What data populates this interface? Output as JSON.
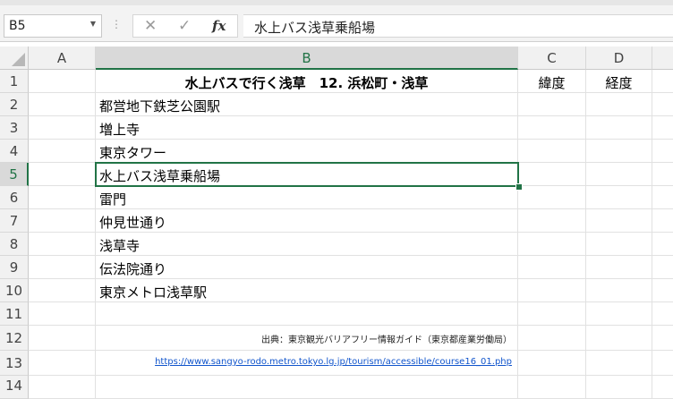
{
  "formula_bar": {
    "name_box": "B5",
    "cancel_icon": "cancel-icon",
    "enter_icon": "check-icon",
    "fx_label": "fx",
    "content": "水上バス浅草乗船場"
  },
  "columns": [
    "A",
    "B",
    "C",
    "D"
  ],
  "rows": [
    "1",
    "2",
    "3",
    "4",
    "5",
    "6",
    "7",
    "8",
    "9",
    "10",
    "11",
    "12",
    "13",
    "14"
  ],
  "cells": {
    "b1": "水上バスで行く浅草　12. 浜松町・浅草",
    "c1": "緯度",
    "d1": "経度",
    "b2": "都営地下鉄芝公園駅",
    "b3": "増上寺",
    "b4": "東京タワー",
    "b5": "水上バス浅草乗船場",
    "b6": "雷門",
    "b7": "仲見世通り",
    "b8": "浅草寺",
    "b9": "伝法院通り",
    "b10": "東京メトロ浅草駅",
    "b12": "出典：東京観光バリアフリー情報ガイド（東京都産業労働局）",
    "b13": "https://www.sangyo-rodo.metro.tokyo.lg.jp/tourism/accessible/course16_01.php"
  },
  "selected_cell": "B5",
  "accent_color": "#217346"
}
